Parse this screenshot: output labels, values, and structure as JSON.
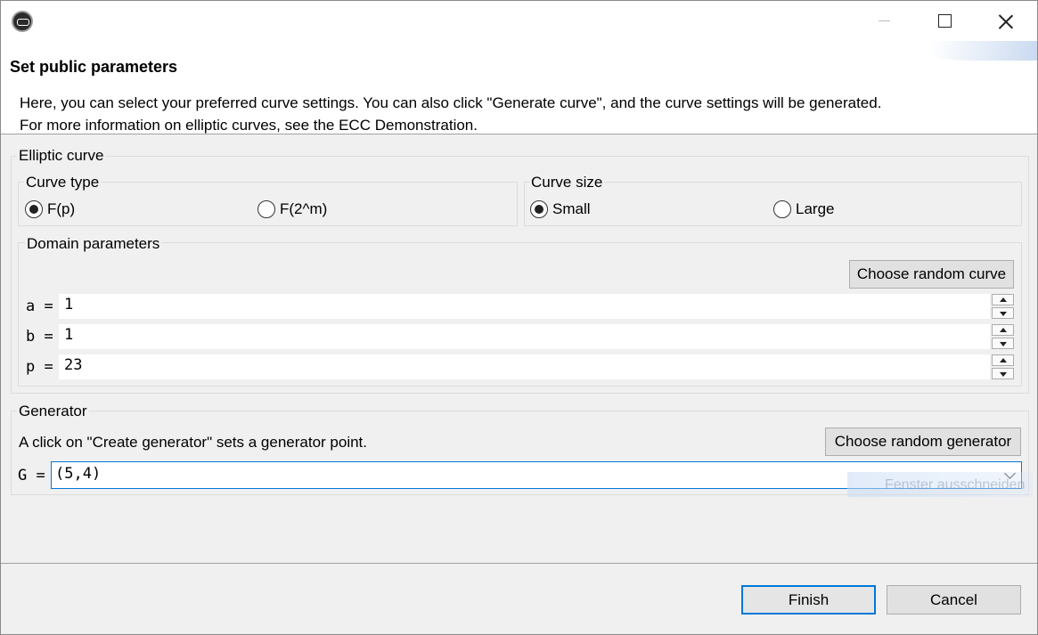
{
  "window": {
    "controls": {
      "minimize_icon": "minimize-icon",
      "maximize_icon": "maximize-icon",
      "close_icon": "close-icon"
    }
  },
  "header": {
    "title": "Set public parameters",
    "description_line1": "Here, you can select your preferred curve settings. You can also click \"Generate curve\", and the curve settings will be generated.",
    "description_line2": "For more information on elliptic curves, see the ECC Demonstration."
  },
  "elliptic_curve": {
    "group_label": "Elliptic curve",
    "curve_type": {
      "label": "Curve type",
      "options": [
        {
          "label": "F(p)",
          "checked": true
        },
        {
          "label": "F(2^m)",
          "checked": false
        }
      ]
    },
    "curve_size": {
      "label": "Curve size",
      "options": [
        {
          "label": "Small",
          "checked": true
        },
        {
          "label": "Large",
          "checked": false
        }
      ]
    },
    "domain": {
      "label": "Domain parameters",
      "random_curve_button": "Choose random curve",
      "params": [
        {
          "label": "a =",
          "value": "1"
        },
        {
          "label": "b =",
          "value": "1"
        },
        {
          "label": "p =",
          "value": "23"
        }
      ]
    }
  },
  "generator": {
    "group_label": "Generator",
    "hint": "A click on \"Create generator\" sets a generator point.",
    "random_button": "Choose random generator",
    "g_label": "G =",
    "g_value": "(5,4)"
  },
  "overlay": {
    "ghost_text": "Fenster ausschneiden"
  },
  "footer": {
    "finish_button": "Finish",
    "cancel_button": "Cancel"
  },
  "colors": {
    "accent": "#0078d7",
    "button_face": "#e1e1e1",
    "dialog_bg": "#f0f0f0"
  }
}
